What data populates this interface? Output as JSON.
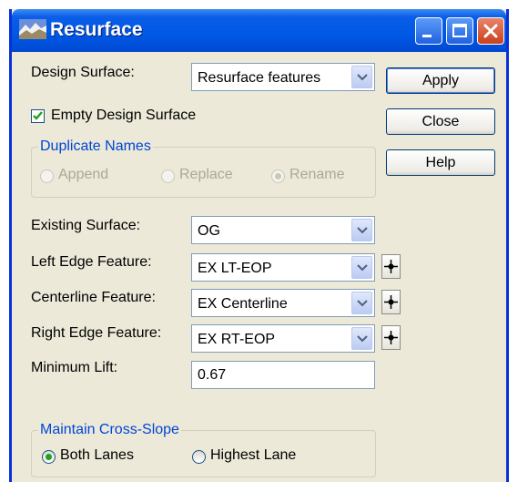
{
  "window": {
    "title": "Resurface"
  },
  "form": {
    "design_surface": {
      "label": "Design Surface:",
      "value": "Resurface features"
    },
    "empty_design_surface": {
      "label": "Empty Design Surface",
      "checked": true
    },
    "duplicate_names": {
      "legend": "Duplicate Names",
      "options": [
        "Append",
        "Replace",
        "Rename"
      ],
      "selected": "Rename",
      "enabled": false
    },
    "existing_surface": {
      "label": "Existing Surface:",
      "value": "OG"
    },
    "left_edge_feature": {
      "label": "Left Edge Feature:",
      "value": "EX LT-EOP"
    },
    "centerline_feature": {
      "label": "Centerline Feature:",
      "value": "EX Centerline"
    },
    "right_edge_feature": {
      "label": "Right Edge Feature:",
      "value": "EX RT-EOP"
    },
    "minimum_lift": {
      "label": "Minimum Lift:",
      "value": "0.67"
    },
    "maintain_cross_slope": {
      "legend": "Maintain Cross-Slope",
      "options": [
        "Both Lanes",
        "Highest Lane"
      ],
      "selected": "Both Lanes"
    }
  },
  "buttons": {
    "apply": "Apply",
    "close": "Close",
    "help": "Help"
  },
  "colors": {
    "titlebar": "#0058e6",
    "dialog_bg": "#ece9d8",
    "group_legend": "#0046d5",
    "check": "#21a121"
  },
  "icons": {
    "app": "terrain-icon",
    "pick": "crosshair-icon",
    "dropdown": "chevron-down-icon"
  }
}
